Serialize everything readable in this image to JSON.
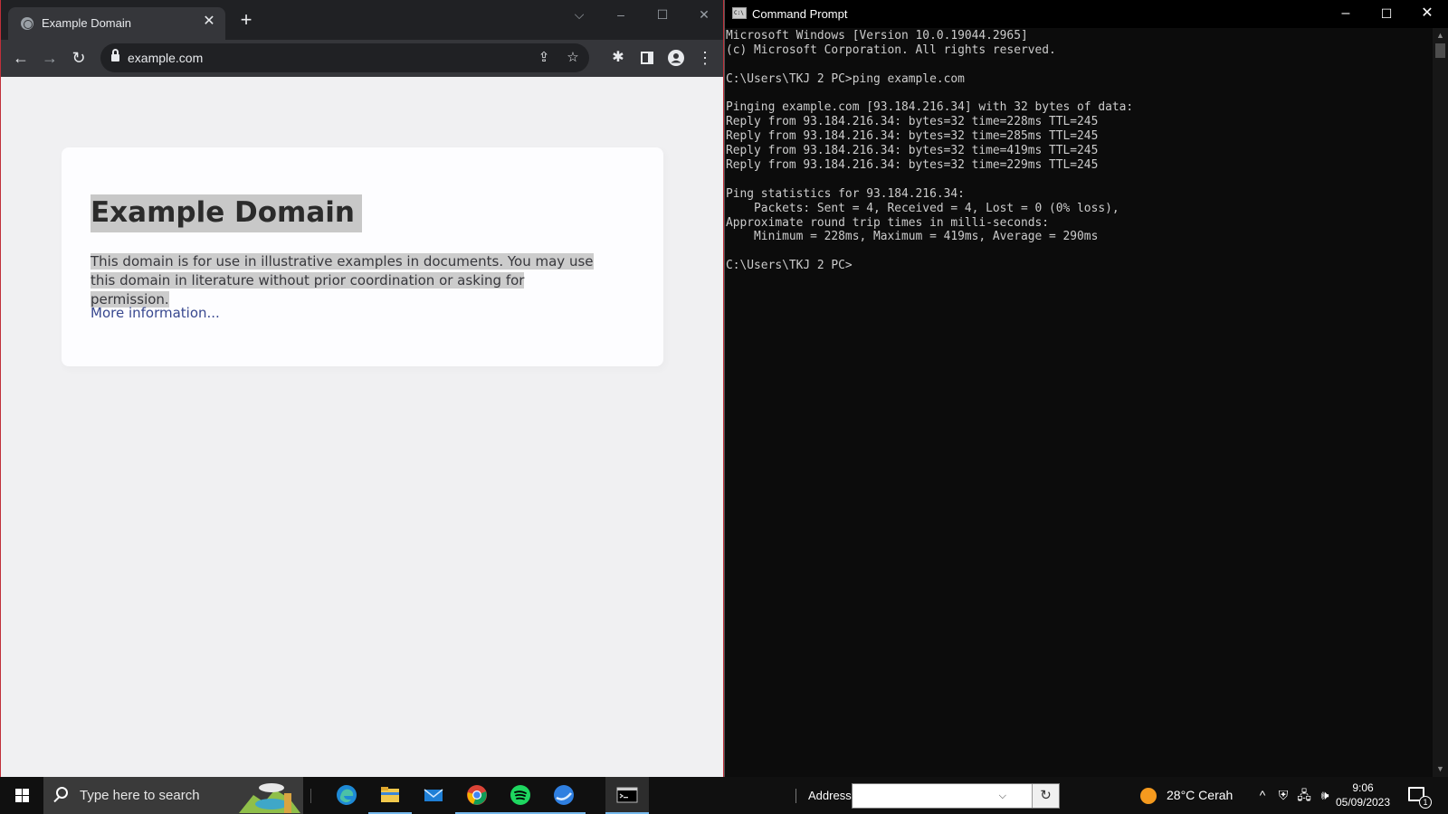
{
  "browser": {
    "tab_title": "Example Domain",
    "tab_close": "✕",
    "new_tab": "+",
    "url": "example.com",
    "page": {
      "heading": "Example Domain",
      "paragraph": "This domain is for use in illustrative examples in documents. You may use this domain in literature without prior coordination or asking for permission.",
      "link": "More information..."
    }
  },
  "cmd": {
    "title": "Command Prompt",
    "output": [
      "Microsoft Windows [Version 10.0.19044.2965]",
      "(c) Microsoft Corporation. All rights reserved.",
      "",
      "C:\\Users\\TKJ 2 PC>ping example.com",
      "",
      "Pinging example.com [93.184.216.34] with 32 bytes of data:",
      "Reply from 93.184.216.34: bytes=32 time=228ms TTL=245",
      "Reply from 93.184.216.34: bytes=32 time=285ms TTL=245",
      "Reply from 93.184.216.34: bytes=32 time=419ms TTL=245",
      "Reply from 93.184.216.34: bytes=32 time=229ms TTL=245",
      "",
      "Ping statistics for 93.184.216.34:",
      "    Packets: Sent = 4, Received = 4, Lost = 0 (0% loss),",
      "Approximate round trip times in milli-seconds:",
      "    Minimum = 228ms, Maximum = 419ms, Average = 290ms",
      "",
      "C:\\Users\\TKJ 2 PC>"
    ]
  },
  "taskbar": {
    "search_placeholder": "Type here to search",
    "address_label": "Address",
    "address_value": "",
    "weather": "28°C  Cerah",
    "time": "9:06",
    "date": "05/09/2023",
    "notification_count": "1",
    "apps": [
      "edge-icon",
      "file-explorer-icon",
      "mail-icon",
      "chrome-icon",
      "spotify-icon",
      "browser-icon",
      "cmd-icon"
    ]
  },
  "colors": {
    "browser_frame": "#202124",
    "browser_toolbar": "#35363a",
    "page_bg": "#f0f0f2",
    "link": "#38488f",
    "console_bg": "#0c0c0c",
    "console_text": "#cccccc",
    "taskbar": "#101010",
    "taskbar_accent": "#76b9ed"
  }
}
